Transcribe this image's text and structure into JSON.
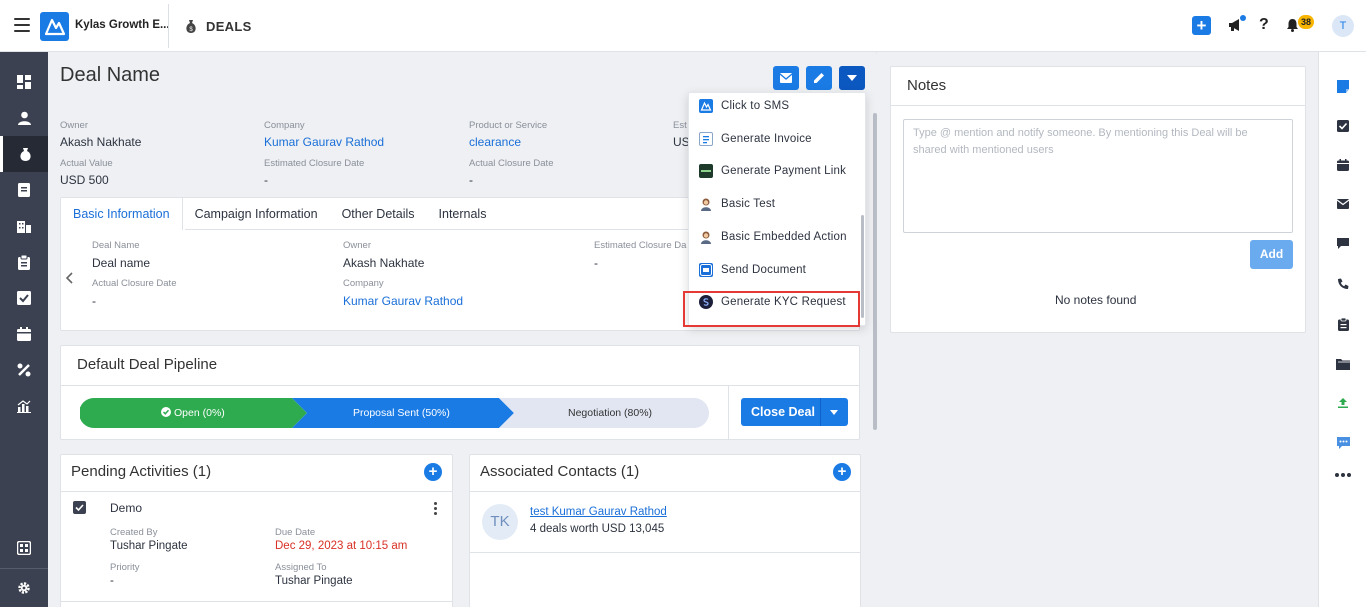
{
  "header": {
    "brand_name": "Kylas Growth E...",
    "module_title": "DEALS",
    "notification_count": "38",
    "user_initial": "T"
  },
  "deal": {
    "title": "Deal Name",
    "summary": [
      {
        "label": "Owner",
        "value": "Akash Nakhate",
        "link": false
      },
      {
        "label": "Company",
        "value": "Kumar Gaurav Rathod",
        "link": true
      },
      {
        "label": "Product or Service",
        "value": "clearance",
        "link": true
      },
      {
        "label": "Est",
        "value": "US",
        "link": false
      },
      {
        "label": "Actual Value",
        "value": "USD 500",
        "link": false
      },
      {
        "label": "Estimated Closure Date",
        "value": "-",
        "link": false
      },
      {
        "label": "Actual Closure Date",
        "value": "-",
        "link": false
      }
    ]
  },
  "tabs": [
    "Basic Information",
    "Campaign Information",
    "Other Details",
    "Internals"
  ],
  "basic_info": [
    {
      "label": "Deal Name",
      "value": "Deal name",
      "link": false
    },
    {
      "label": "Owner",
      "value": "Akash Nakhate",
      "link": false
    },
    {
      "label": "Estimated Closure Da",
      "value": "-",
      "link": false
    },
    {
      "label": "Actual Closure Date",
      "value": "-",
      "link": false
    },
    {
      "label": "Company",
      "value": "Kumar Gaurav Rathod",
      "link": true
    }
  ],
  "pipeline": {
    "title": "Default Deal Pipeline",
    "stages": [
      {
        "label": "Open (0%)",
        "status": "done",
        "color": "#2eaa4f"
      },
      {
        "label": "Proposal Sent (50%)",
        "status": "current",
        "color": "#1a7be5"
      },
      {
        "label": "Negotiation (80%)",
        "status": "pending",
        "color": "#e2e6f2"
      }
    ],
    "close_button": "Close Deal"
  },
  "pending_activities": {
    "title": "Pending Activities (1)",
    "item": {
      "name": "Demo",
      "created_by_label": "Created By",
      "created_by": "Tushar Pingate",
      "due_label": "Due Date",
      "due": "Dec 29, 2023 at 10:15 am",
      "priority_label": "Priority",
      "priority": "-",
      "assigned_label": "Assigned To",
      "assigned": "Tushar Pingate"
    }
  },
  "associated_contacts": {
    "title": "Associated Contacts (1)",
    "contact": {
      "initials": "TK",
      "name": "test Kumar Gaurav Rathod",
      "summary": "4 deals worth USD 13,045"
    }
  },
  "actions_menu": [
    {
      "label": "Click to SMS",
      "icon": "kylas-logo-icon"
    },
    {
      "label": "Generate Invoice",
      "icon": "invoice-icon"
    },
    {
      "label": "Generate Payment Link",
      "icon": "payment-link-icon"
    },
    {
      "label": "Basic Test",
      "icon": "person-icon"
    },
    {
      "label": "Basic Embedded Action",
      "icon": "person-icon"
    },
    {
      "label": "Send Document",
      "icon": "digio-icon"
    },
    {
      "label": "Generate KYC Request",
      "icon": "kyc-icon"
    }
  ],
  "notes": {
    "title": "Notes",
    "placeholder": "Type @ mention and notify someone. By mentioning this Deal will be shared with mentioned users",
    "add_button": "Add",
    "empty_text": "No notes found"
  },
  "left_nav": [
    "dashboard-icon",
    "contacts-icon",
    "deals-icon",
    "leads-icon",
    "companies-icon",
    "reports-icon",
    "tasks-icon",
    "calendar-icon",
    "integrations-icon",
    "analytics-icon",
    "apps-icon",
    "settings-icon"
  ],
  "right_rail": [
    "notes-icon",
    "tasks-icon",
    "calendar-icon",
    "email-icon",
    "chat-icon",
    "phone-icon",
    "clipboard-icon",
    "folder-icon",
    "upload-icon",
    "message-icon",
    "more-icon"
  ],
  "colors": {
    "accent": "#1a7be5",
    "sidebar": "#3b4150",
    "success": "#2eaa4f",
    "danger": "#d93025",
    "highlight": "#e53935"
  }
}
